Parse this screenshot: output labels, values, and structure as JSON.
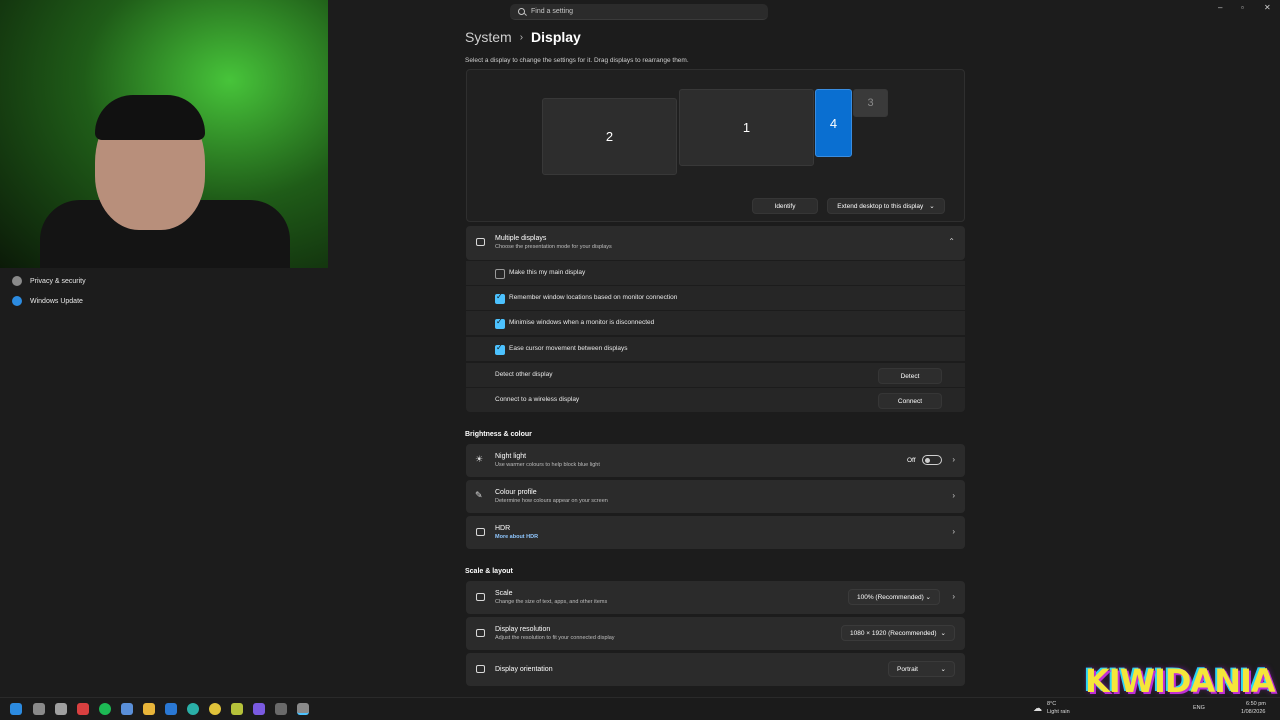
{
  "search": {
    "placeholder": "Find a setting"
  },
  "breadcrumb": {
    "parent": "System",
    "current": "Display"
  },
  "hint": "Select a display to change the settings for it. Drag displays to rearrange them.",
  "monitors": [
    "2",
    "1",
    "4",
    "3"
  ],
  "arrangement": {
    "identify_label": "Identify",
    "extend_label": "Extend desktop to this display"
  },
  "sidebar": {
    "items": [
      {
        "label": "Privacy & security"
      },
      {
        "label": "Windows Update"
      }
    ]
  },
  "multiple_displays": {
    "title": "Multiple displays",
    "subtitle": "Choose the presentation mode for your displays",
    "options": [
      {
        "label": "Make this my main display",
        "checked": false
      },
      {
        "label": "Remember window locations based on monitor connection",
        "checked": true
      },
      {
        "label": "Minimise windows when a monitor is disconnected",
        "checked": true
      },
      {
        "label": "Ease cursor movement between displays",
        "checked": true
      }
    ],
    "detect_label": "Detect other display",
    "detect_button": "Detect",
    "wireless_label": "Connect to a wireless display",
    "connect_button": "Connect"
  },
  "brightness": {
    "heading": "Brightness & colour",
    "night_light": {
      "title": "Night light",
      "subtitle": "Use warmer colours to help block blue light",
      "state": "Off"
    },
    "colour_profile": {
      "title": "Colour profile",
      "subtitle": "Determine how colours appear on your screen"
    },
    "hdr": {
      "title": "HDR",
      "subtitle": "More about HDR"
    }
  },
  "scale_layout": {
    "heading": "Scale & layout",
    "scale": {
      "title": "Scale",
      "subtitle": "Change the size of text, apps, and other items",
      "value": "100% (Recommended)"
    },
    "resolution": {
      "title": "Display resolution",
      "subtitle": "Adjust the resolution to fit your connected display",
      "value": "1080 × 1920 (Recommended)"
    },
    "orientation": {
      "title": "Display orientation",
      "value": "Portrait"
    }
  },
  "tray": {
    "temp": "8°C",
    "weather": "Light rain",
    "lang": "ENG",
    "time": "6:50 pm",
    "date": "1/08/2026"
  },
  "overlay": {
    "logo_text": "KIWIDANIA"
  },
  "colors": {
    "accent": "#0a6fd1",
    "checkbox": "#4cc2ff",
    "background": "#1c1c1c",
    "card": "#2b2b2b"
  }
}
